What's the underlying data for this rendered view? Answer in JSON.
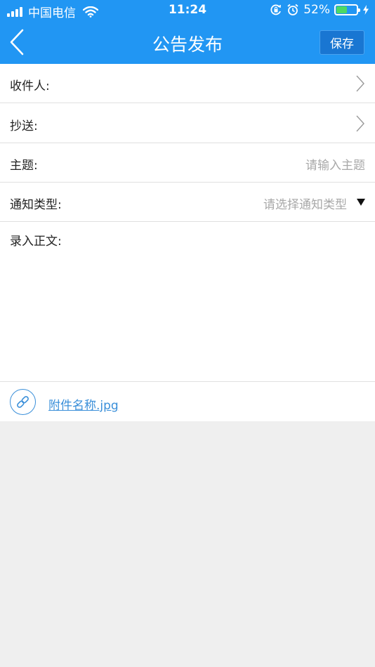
{
  "status_bar": {
    "carrier": "中国电信",
    "time": "11:24",
    "battery_percent": "52%",
    "battery_level": 0.52,
    "battery_color": "#4cd964"
  },
  "nav": {
    "title": "公告发布",
    "save_label": "保存",
    "back_icon": "chevron-left-icon",
    "color": "#2196f3"
  },
  "form": {
    "recipient_label": "收件人:",
    "cc_label": "抄送:",
    "subject_label": "主题:",
    "subject_placeholder": "请输入主题",
    "notice_type_label": "通知类型:",
    "notice_type_placeholder": "请选择通知类型",
    "body_label": "录入正文:"
  },
  "attachment": {
    "icon": "link-icon",
    "file_name": "附件名称.jpg"
  }
}
